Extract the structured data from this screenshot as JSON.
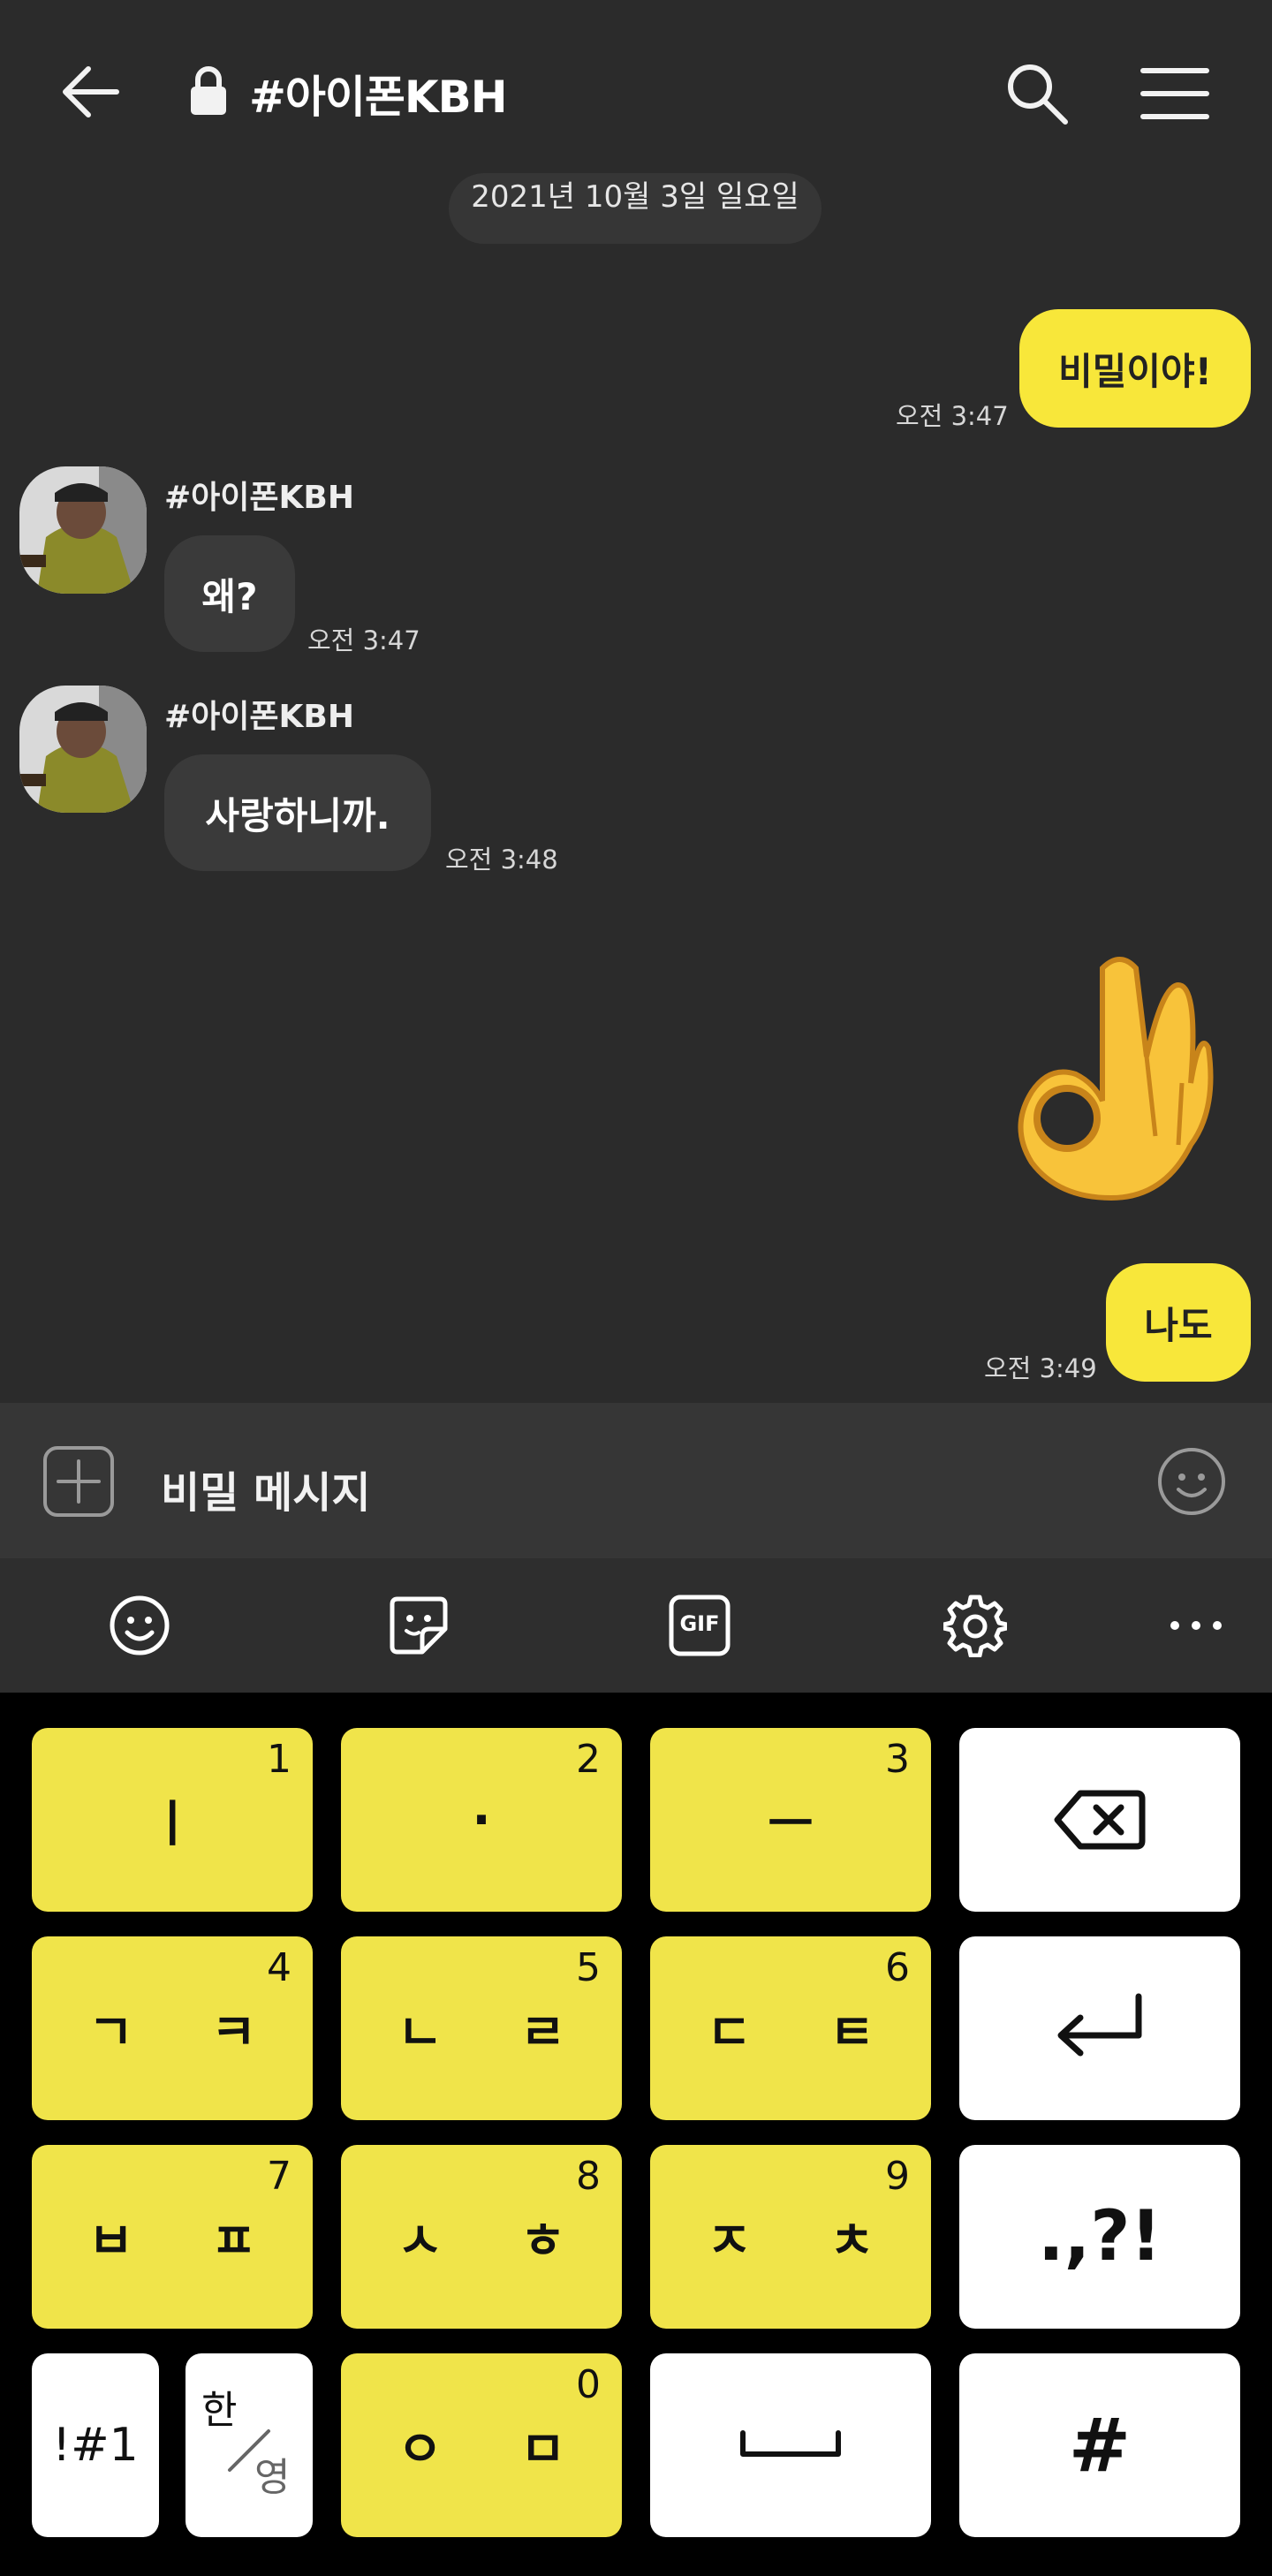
{
  "header": {
    "title": "#아이폰KBH",
    "icons": [
      "back-arrow-icon",
      "lock-icon",
      "search-icon",
      "menu-icon"
    ]
  },
  "chat": {
    "date_label": "2021년 10월 3일 일요일",
    "messages": [
      {
        "from": "me",
        "text": "비밀이야!",
        "time": "오전 3:47"
      },
      {
        "from": "other",
        "sender": "#아이폰KBH",
        "text": "왜?",
        "time": "오전 3:47"
      },
      {
        "from": "other",
        "sender": "#아이폰KBH",
        "text": "사랑하니까.",
        "time": "오전 3:48"
      },
      {
        "from": "me",
        "emoji": "👌",
        "text": "나도",
        "time": "오전 3:49"
      }
    ]
  },
  "input": {
    "placeholder": "비밀 메시지",
    "icons": [
      "plus-icon",
      "emoticon-icon"
    ]
  },
  "toolbar": {
    "items": [
      "emoji-icon",
      "sticker-icon",
      "gif-icon",
      "settings-icon",
      "more-icon"
    ],
    "gif_label": "GIF"
  },
  "keyboard": {
    "rows": [
      [
        {
          "label": "ㅣ",
          "num": "1"
        },
        {
          "label": "·",
          "num": "2"
        },
        {
          "label": "ㅡ",
          "num": "3"
        },
        {
          "label": "backspace-icon"
        }
      ],
      [
        {
          "label": "ㄱ ㅋ",
          "num": "4"
        },
        {
          "label": "ㄴ ㄹ",
          "num": "5"
        },
        {
          "label": "ㄷ ㅌ",
          "num": "6"
        },
        {
          "label": "enter-icon"
        }
      ],
      [
        {
          "label": "ㅂ ㅍ",
          "num": "7"
        },
        {
          "label": "ㅅ ㅎ",
          "num": "8"
        },
        {
          "label": "ㅈ ㅊ",
          "num": "9"
        },
        {
          "label": ".,?!"
        }
      ],
      [
        {
          "label": "!#1"
        },
        {
          "label": "한/영"
        },
        {
          "label": "ㅇ ㅁ",
          "num": "0"
        },
        {
          "label": "space-icon"
        },
        {
          "label": "#"
        }
      ]
    ],
    "han": "한",
    "yeong": "영"
  },
  "colors": {
    "background": "#2b2b2b",
    "my_bubble": "#f8e73a",
    "other_bubble": "#3a3a3a",
    "key_yellow": "#f0e44a",
    "key_white": "#ffffff",
    "keyboard_bg": "#000000"
  }
}
